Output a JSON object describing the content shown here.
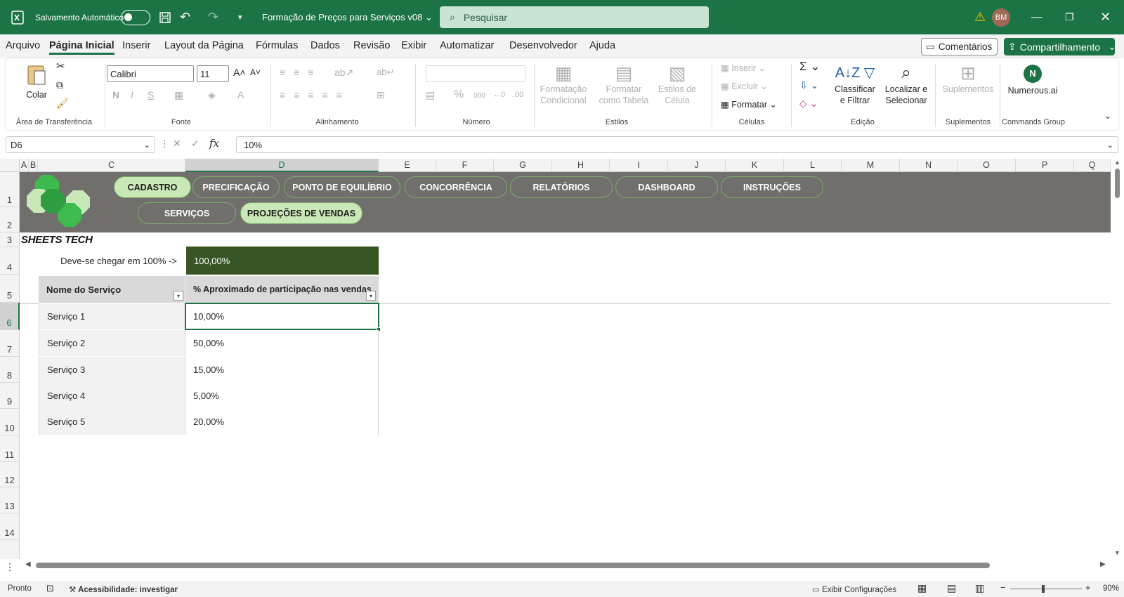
{
  "titlebar": {
    "autosave_label": "Salvamento Automático",
    "doc_title": "Formação de Preços para Serviços  v08",
    "search_placeholder": "Pesquisar",
    "avatar_initials": "BM"
  },
  "menu": {
    "items": [
      "Arquivo",
      "Página Inicial",
      "Inserir",
      "Layout da Página",
      "Fórmulas",
      "Dados",
      "Revisão",
      "Exibir",
      "Automatizar",
      "Desenvolvedor",
      "Ajuda"
    ],
    "active": "Página Inicial",
    "comments": "Comentários",
    "share": "Compartilhamento"
  },
  "ribbon": {
    "clipboard": {
      "paste": "Colar",
      "label": "Área de Transferência"
    },
    "font": {
      "name": "Calibri",
      "size": "11",
      "label": "Fonte"
    },
    "alignment": {
      "label": "Alinhamento"
    },
    "number": {
      "label": "Número"
    },
    "styles": {
      "cond": "Formatação Condicional",
      "table": "Formatar como Tabela",
      "cell": "Estilos de Célula",
      "label": "Estilos"
    },
    "cells": {
      "insert": "Inserir",
      "delete": "Excluir",
      "format": "Formatar",
      "label": "Células"
    },
    "editing": {
      "sort": "Classificar e Filtrar",
      "find": "Localizar e Selecionar",
      "label": "Edição"
    },
    "addins": {
      "btn": "Suplementos",
      "label": "Suplementos"
    },
    "commands": {
      "btn": "Numerous.ai",
      "label": "Commands Group"
    }
  },
  "formula_bar": {
    "cell_ref": "D6",
    "formula": "10%"
  },
  "columns": [
    "A",
    "B",
    "C",
    "D",
    "E",
    "F",
    "G",
    "H",
    "I",
    "J",
    "K",
    "L",
    "M",
    "N",
    "O",
    "P",
    "Q"
  ],
  "rows": [
    "1",
    "2",
    "3",
    "4",
    "5",
    "6",
    "7",
    "8",
    "9",
    "10",
    "11",
    "12",
    "13",
    "14"
  ],
  "banner": {
    "nav_top": [
      "CADASTRO",
      "PRECIFICAÇÃO",
      "PONTO DE EQUILÍBRIO",
      "CONCORRÊNCIA",
      "RELATÓRIOS",
      "DASHBOARD",
      "INSTRUÇÕES"
    ],
    "nav_bottom": [
      "SERVIÇOS",
      "PROJEÇÕES DE VENDAS"
    ],
    "brand": "SHEETS TECH",
    "logo_color": "#3dbb4f"
  },
  "sheet": {
    "target_label": "Deve-se chegar em 100% ->",
    "target_value": "100,00%",
    "header_name": "Nome do Serviço",
    "header_pct": "% Aproximado de participação nas vendas",
    "rows": [
      {
        "name": "Serviço 1",
        "pct": "10,00%"
      },
      {
        "name": "Serviço 2",
        "pct": "50,00%"
      },
      {
        "name": "Serviço 3",
        "pct": "15,00%"
      },
      {
        "name": "Serviço 4",
        "pct": "5,00%"
      },
      {
        "name": "Serviço 5",
        "pct": "20,00%"
      }
    ]
  },
  "status": {
    "ready": "Pronto",
    "accessibility": "Acessibilidade: investigar",
    "display_settings": "Exibir Configurações",
    "zoom": "90%"
  },
  "colors": {
    "excel_green": "#1c7346",
    "banner_gray": "#716f6c",
    "target_fill": "#375623",
    "nav_active": "#c9e7b7"
  }
}
